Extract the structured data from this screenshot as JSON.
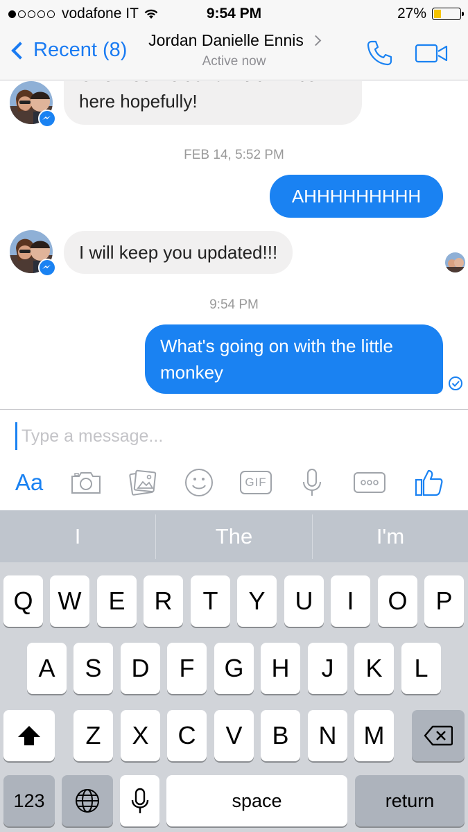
{
  "status_bar": {
    "carrier": "vodafone IT",
    "time": "9:54 PM",
    "battery_percent": "27%",
    "battery_level": 0.27,
    "signal_bars_filled": 1,
    "signal_bars_total": 5,
    "icons": [
      "signal-dots-icon",
      "wifi-icon",
      "battery-icon"
    ]
  },
  "nav": {
    "back_label": "Recent (8)",
    "contact_name": "Jordan Danielle Ennis",
    "contact_status": "Active now",
    "icons": [
      "back-chevron-icon",
      "chevron-right-icon",
      "phone-icon",
      "video-camera-icon"
    ],
    "accent_color": "#1a7bf2"
  },
  "messages": [
    {
      "direction": "incoming",
      "text_partial": "One week left and Holt will be",
      "text": "here hopefully!"
    },
    {
      "type": "timestamp",
      "text": "FEB 14, 5:52 PM"
    },
    {
      "direction": "outgoing",
      "text": "AHHHHHHHHH"
    },
    {
      "direction": "incoming",
      "text": "I will keep you updated!!!"
    },
    {
      "type": "timestamp",
      "text": "9:54 PM"
    },
    {
      "direction": "outgoing",
      "text_line1": "What's going on with the little",
      "text_line2": "monkey"
    }
  ],
  "compose": {
    "placeholder": "Type a message...",
    "aa_label": "Aa",
    "gif_label": "GIF",
    "icons": [
      "camera-icon",
      "photo-gallery-icon",
      "emoji-icon",
      "gif-icon",
      "microphone-icon",
      "more-icon",
      "thumbs-up-icon"
    ]
  },
  "keyboard": {
    "suggestions": [
      "I",
      "The",
      "I'm"
    ],
    "row1": [
      "Q",
      "W",
      "E",
      "R",
      "T",
      "Y",
      "U",
      "I",
      "O",
      "P"
    ],
    "row2": [
      "A",
      "S",
      "D",
      "F",
      "G",
      "H",
      "J",
      "K",
      "L"
    ],
    "row3": [
      "Z",
      "X",
      "C",
      "V",
      "B",
      "N",
      "M"
    ],
    "numbers_label": "123",
    "space_label": "space",
    "return_label": "return",
    "icons": [
      "shift-icon",
      "backspace-icon",
      "globe-icon",
      "dictation-microphone-icon"
    ]
  }
}
